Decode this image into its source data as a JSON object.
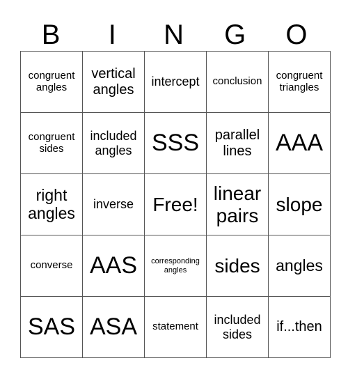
{
  "title_letters": [
    "B",
    "I",
    "N",
    "G",
    "O"
  ],
  "rows": [
    [
      "congruent angles",
      "vertical angles",
      "intercept",
      "conclusion",
      "congruent triangles"
    ],
    [
      "congruent sides",
      "included angles",
      "SSS",
      "parallel lines",
      "AAA"
    ],
    [
      "right angles",
      "inverse",
      "Free!",
      "linear pairs",
      "slope"
    ],
    [
      "converse",
      "AAS",
      "corresponding angles",
      "sides",
      "angles"
    ],
    [
      "SAS",
      "ASA",
      "statement",
      "included sides",
      "if...then"
    ]
  ]
}
